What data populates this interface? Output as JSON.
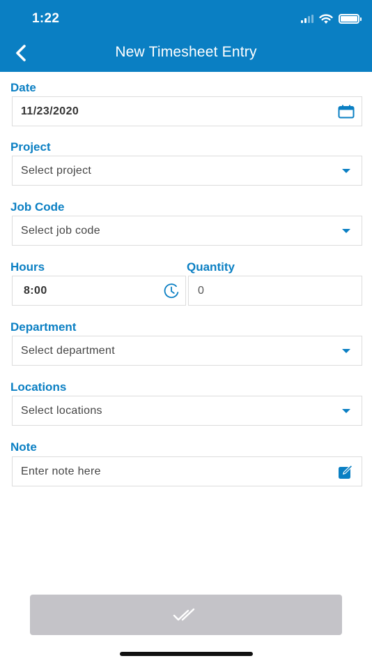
{
  "status_bar": {
    "time": "1:22"
  },
  "nav": {
    "title": "New Timesheet Entry"
  },
  "form": {
    "date": {
      "label": "Date",
      "value": "11/23/2020"
    },
    "project": {
      "label": "Project",
      "placeholder": "Select project"
    },
    "job_code": {
      "label": "Job Code",
      "placeholder": "Select job code"
    },
    "hours": {
      "label": "Hours",
      "value": "8:00"
    },
    "quantity": {
      "label": "Quantity",
      "value": "0"
    },
    "department": {
      "label": "Department",
      "placeholder": "Select department"
    },
    "locations": {
      "label": "Locations",
      "placeholder": "Select locations"
    },
    "note": {
      "label": "Note",
      "placeholder": "Enter note here"
    }
  },
  "icons": {
    "back": "chevron-left-icon",
    "calendar": "calendar-icon",
    "clock": "clock-icon",
    "dropdown": "caret-down-icon",
    "edit": "edit-note-icon",
    "submit": "double-check-icon"
  },
  "colors": {
    "primary": "#0a7fc3",
    "submit_disabled": "#c4c3c8",
    "border": "#dcdcdc"
  }
}
